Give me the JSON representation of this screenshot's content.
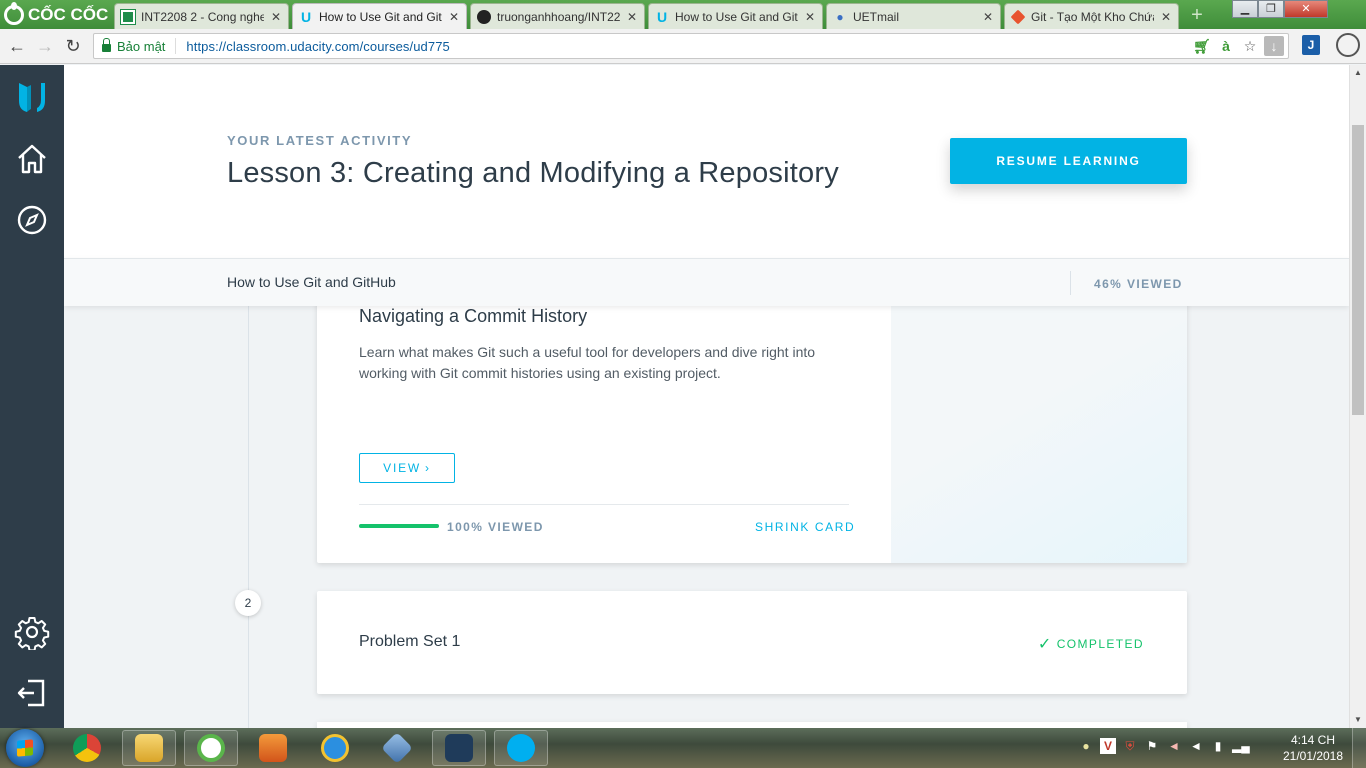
{
  "browser": {
    "brand": "CỐC CỐC",
    "tabs": [
      {
        "title": "INT2208 2 - Cong nghe",
        "icon": "spreadsheet-icon",
        "active": false
      },
      {
        "title": "How to Use Git and Git",
        "icon": "udacity-icon",
        "active": true
      },
      {
        "title": "truonganhhoang/INT22",
        "icon": "github-icon",
        "active": false
      },
      {
        "title": "How to Use Git and Git",
        "icon": "udacity-icon",
        "active": false
      },
      {
        "title": "UETmail",
        "icon": "mail-icon",
        "active": false
      },
      {
        "title": "Git - Tạo Một Kho Chứa",
        "icon": "git-icon",
        "active": false
      }
    ],
    "close_glyph": "✕",
    "secure_label": "Bảo mật",
    "url": "https://classroom.udacity.com/courses/ud775"
  },
  "sidebar": {
    "items": [
      {
        "name": "udacity-logo-icon"
      },
      {
        "name": "home-icon"
      },
      {
        "name": "compass-icon"
      },
      {
        "name": "settings-gear-icon"
      },
      {
        "name": "logout-icon"
      }
    ]
  },
  "hero": {
    "eyebrow": "YOUR LATEST ACTIVITY",
    "lesson_title": "Lesson 3: Creating and Modifying a Repository",
    "resume_label": "RESUME LEARNING"
  },
  "course_bar": {
    "course_name": "How to Use Git and GitHub",
    "progress_label": "46% VIEWED"
  },
  "lesson_card": {
    "title": "Navigating a Commit History",
    "description": "Learn what makes Git such a useful tool for developers and dive right into working with Git commit histories using an existing project.",
    "view_label": "VIEW",
    "view_chevron": "›",
    "progress_fraction": 1.0,
    "progress_label": "100% VIEWED",
    "shrink_label": "SHRINK CARD"
  },
  "problem_set": {
    "step_number": "2",
    "title": "Problem Set 1",
    "status_label": "COMPLETED",
    "status_check": "✓"
  },
  "taskbar": {
    "apps": [
      "chrome-icon",
      "file-explorer-icon",
      "coccoc-icon",
      "media-player-icon",
      "internet-explorer-icon",
      "virtualbox-icon",
      "mysql-workbench-icon",
      "skype-icon"
    ],
    "time": "4:14 CH",
    "date": "21/01/2018"
  },
  "colors": {
    "accent": "#02b3e4",
    "sidebar": "#2e3d49",
    "success": "#15c26b",
    "muted": "#7d97ad",
    "browser_green": "#4a9c45"
  }
}
